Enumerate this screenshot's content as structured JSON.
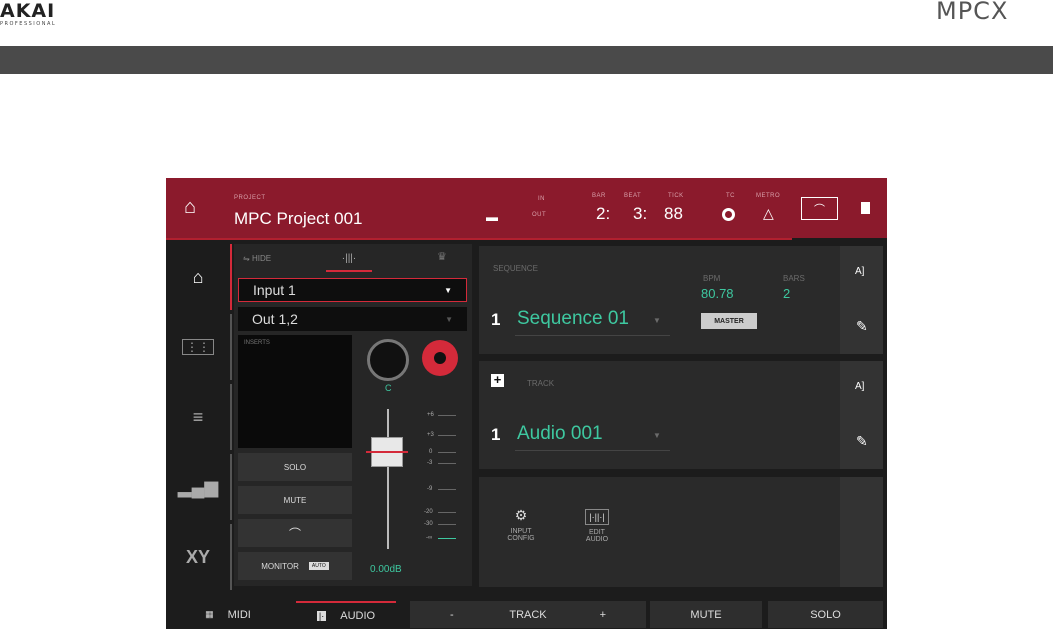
{
  "brand": {
    "left": "AKAI",
    "left_sub": "PROFESSIONAL",
    "right": "MPCX"
  },
  "header": {
    "project_label": "PROJECT",
    "project_name": "MPC Project 001",
    "in_label": "IN",
    "out_label": "OUT",
    "bar_label": "BAR",
    "beat_label": "BEAT",
    "tick_label": "TICK",
    "bar": "2:",
    "beat": "3:",
    "tick": "88",
    "tc_label": "TC",
    "metro_label": "METRO"
  },
  "channel": {
    "tabs": {
      "hide": "HIDE"
    },
    "input": "Input 1",
    "output": "Out 1,2",
    "inserts_label": "INSERTS",
    "pan_value": "C",
    "solo": "SOLO",
    "mute": "MUTE",
    "monitor": "MONITOR",
    "monitor_badge": "AUTO",
    "level": "0.00dB",
    "ticks": [
      "+6",
      "+3",
      "0",
      "-3",
      "-9",
      "-20",
      "-30",
      "-∞"
    ]
  },
  "sequence": {
    "label": "SEQUENCE",
    "number": "1",
    "name": "Sequence 01",
    "bpm_label": "BPM",
    "bpm": "80.78",
    "bars_label": "BARS",
    "bars": "2",
    "master": "MASTER"
  },
  "track": {
    "label": "TRACK",
    "number": "1",
    "name": "Audio 001"
  },
  "tools": {
    "input_config": [
      "INPUT",
      "CONFIG"
    ],
    "edit_audio": [
      "EDIT",
      "AUDIO"
    ]
  },
  "footer": {
    "midi": "MIDI",
    "audio": "AUDIO",
    "minus": "-",
    "track": "TRACK",
    "plus": "+",
    "mute": "MUTE",
    "solo": "SOLO"
  },
  "colors": {
    "header": "#8b1a2c",
    "accent": "#d42a3a",
    "teal": "#3ec8a0"
  }
}
